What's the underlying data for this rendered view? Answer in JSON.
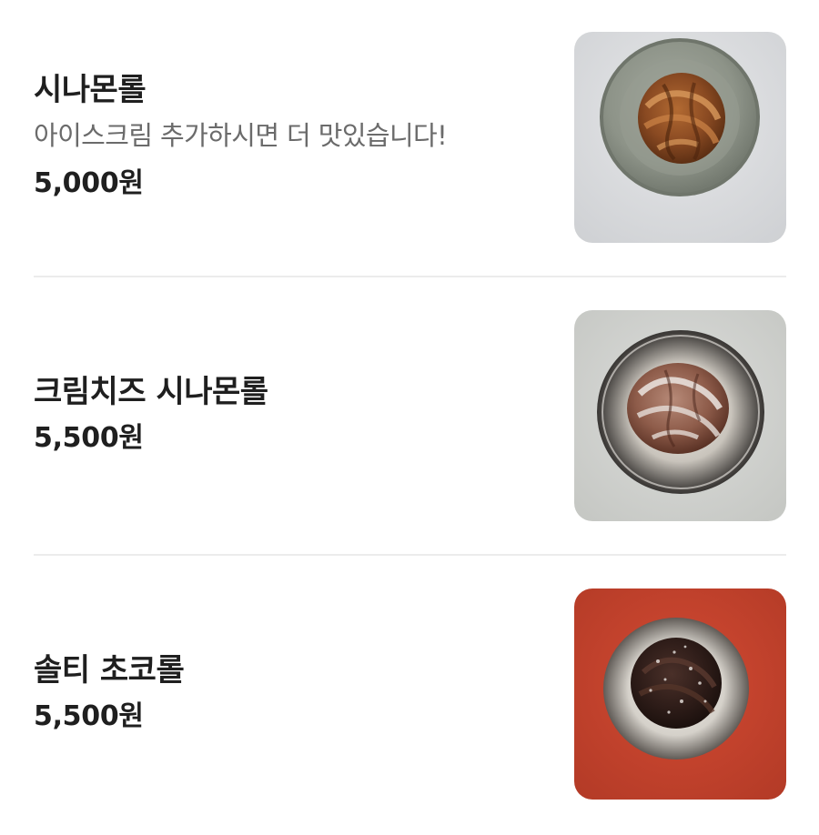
{
  "menu": {
    "items": [
      {
        "name": "시나몬롤",
        "description": "아이스크림 추가하시면 더 맛있습니다!",
        "price": "5,000원",
        "image_icon": "cinnamon-roll-photo",
        "background_color": "#d6d8da"
      },
      {
        "name": "크림치즈 시나몬롤",
        "price": "5,500원",
        "image_icon": "cream-cheese-cinnamon-roll-photo",
        "background_color": "#cfd0cc"
      },
      {
        "name": "솔티 초코롤",
        "price": "5,500원",
        "image_icon": "salty-choco-roll-photo",
        "background_color": "#c8402b"
      }
    ]
  }
}
